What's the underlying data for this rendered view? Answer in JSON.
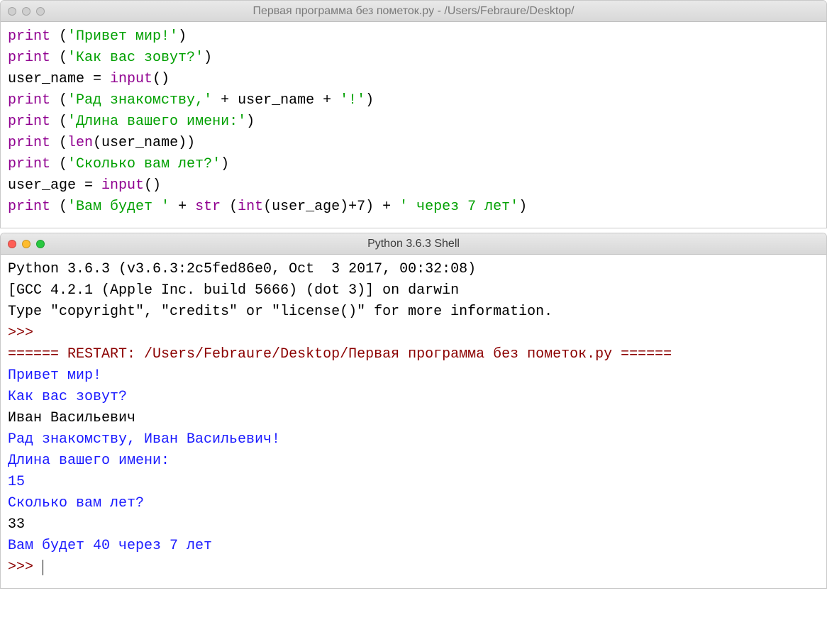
{
  "editor": {
    "title": "Первая программа без пометок.py - /Users/Febraure/Desktop/",
    "lines": [
      [
        {
          "cls": "t-kw",
          "txt": "print"
        },
        {
          "cls": "t-def",
          "txt": " ("
        },
        {
          "cls": "t-str",
          "txt": "'Привет мир!'"
        },
        {
          "cls": "t-def",
          "txt": ")"
        }
      ],
      [
        {
          "cls": "t-kw",
          "txt": "print"
        },
        {
          "cls": "t-def",
          "txt": " ("
        },
        {
          "cls": "t-str",
          "txt": "'Как вас зовут?'"
        },
        {
          "cls": "t-def",
          "txt": ")"
        }
      ],
      [
        {
          "cls": "t-def",
          "txt": "user_name = "
        },
        {
          "cls": "t-kw",
          "txt": "input"
        },
        {
          "cls": "t-def",
          "txt": "()"
        }
      ],
      [
        {
          "cls": "t-kw",
          "txt": "print"
        },
        {
          "cls": "t-def",
          "txt": " ("
        },
        {
          "cls": "t-str",
          "txt": "'Рад знакомству,'"
        },
        {
          "cls": "t-def",
          "txt": " + user_name + "
        },
        {
          "cls": "t-str",
          "txt": "'!'"
        },
        {
          "cls": "t-def",
          "txt": ")"
        }
      ],
      [
        {
          "cls": "t-kw",
          "txt": "print"
        },
        {
          "cls": "t-def",
          "txt": " ("
        },
        {
          "cls": "t-str",
          "txt": "'Длина вашего имени:'"
        },
        {
          "cls": "t-def",
          "txt": ")"
        }
      ],
      [
        {
          "cls": "t-kw",
          "txt": "print"
        },
        {
          "cls": "t-def",
          "txt": " ("
        },
        {
          "cls": "t-kw",
          "txt": "len"
        },
        {
          "cls": "t-def",
          "txt": "(user_name))"
        }
      ],
      [
        {
          "cls": "t-kw",
          "txt": "print"
        },
        {
          "cls": "t-def",
          "txt": " ("
        },
        {
          "cls": "t-str",
          "txt": "'Сколько вам лет?'"
        },
        {
          "cls": "t-def",
          "txt": ")"
        }
      ],
      [
        {
          "cls": "t-def",
          "txt": "user_age = "
        },
        {
          "cls": "t-kw",
          "txt": "input"
        },
        {
          "cls": "t-def",
          "txt": "()"
        }
      ],
      [
        {
          "cls": "t-kw",
          "txt": "print"
        },
        {
          "cls": "t-def",
          "txt": " ("
        },
        {
          "cls": "t-str",
          "txt": "'Вам будет '"
        },
        {
          "cls": "t-def",
          "txt": " + "
        },
        {
          "cls": "t-kw",
          "txt": "str"
        },
        {
          "cls": "t-def",
          "txt": " ("
        },
        {
          "cls": "t-kw",
          "txt": "int"
        },
        {
          "cls": "t-def",
          "txt": "(user_age)+7) + "
        },
        {
          "cls": "t-str",
          "txt": "' через 7 лет'"
        },
        {
          "cls": "t-def",
          "txt": ")"
        }
      ]
    ]
  },
  "shell": {
    "title": "Python 3.6.3 Shell",
    "lines": [
      [
        {
          "cls": "s-in",
          "txt": "Python 3.6.3 (v3.6.3:2c5fed86e0, Oct  3 2017, 00:32:08) "
        }
      ],
      [
        {
          "cls": "s-in",
          "txt": "[GCC 4.2.1 (Apple Inc. build 5666) (dot 3)] on darwin"
        }
      ],
      [
        {
          "cls": "s-in",
          "txt": "Type \"copyright\", \"credits\" or \"license()\" for more information."
        }
      ],
      [
        {
          "cls": "s-prm",
          "txt": ">>> "
        }
      ],
      [
        {
          "cls": "s-prm",
          "txt": "====== RESTART: /Users/Febraure/Desktop/Первая программа без пометок.py ======"
        }
      ],
      [
        {
          "cls": "s-out",
          "txt": "Привет мир!"
        }
      ],
      [
        {
          "cls": "s-out",
          "txt": "Как вас зовут?"
        }
      ],
      [
        {
          "cls": "s-in",
          "txt": "Иван Васильевич"
        }
      ],
      [
        {
          "cls": "s-out",
          "txt": "Рад знакомству, Иван Васильевич!"
        }
      ],
      [
        {
          "cls": "s-out",
          "txt": "Длина вашего имени:"
        }
      ],
      [
        {
          "cls": "s-out",
          "txt": "15"
        }
      ],
      [
        {
          "cls": "s-out",
          "txt": "Сколько вам лет?"
        }
      ],
      [
        {
          "cls": "s-in",
          "txt": "33"
        }
      ],
      [
        {
          "cls": "s-out",
          "txt": "Вам будет 40 через 7 лет"
        }
      ],
      [
        {
          "cls": "s-prm",
          "txt": ">>> "
        }
      ]
    ]
  }
}
